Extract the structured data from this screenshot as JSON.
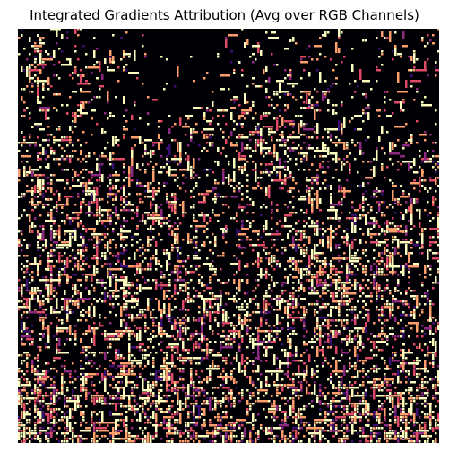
{
  "figure": {
    "title": "Integrated Gradients Attribution (Avg over RGB Channels)"
  },
  "heatmap": {
    "colormap": "magma",
    "background_color": "#000004",
    "colors": [
      "#000004",
      "#3b0f70",
      "#8c2981",
      "#de4968",
      "#fe9f6d",
      "#fcfdbf"
    ],
    "axes_visible": false
  }
}
